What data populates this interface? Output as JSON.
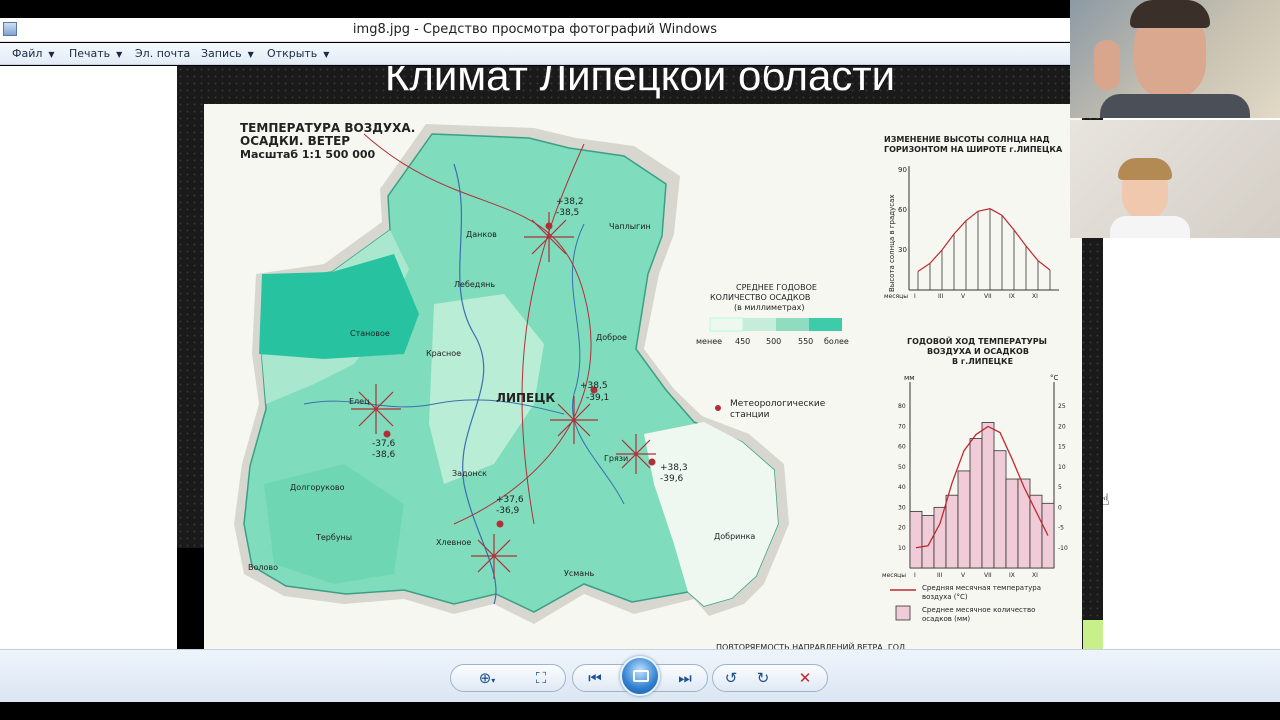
{
  "window": {
    "title": "img8.jpg - Средство просмотра фотографий Windows"
  },
  "menu": {
    "items": [
      {
        "label": "Файл",
        "has_caret": true
      },
      {
        "label": "Печать",
        "has_caret": true
      },
      {
        "label": "Эл. почта",
        "has_caret": false
      },
      {
        "label": "Запись",
        "has_caret": true
      },
      {
        "label": "Открыть",
        "has_caret": true
      }
    ]
  },
  "slide": {
    "title": "Климат Липецкой области"
  },
  "map": {
    "title_line1": "ТЕМПЕРАТУРА ВОЗДУХА.",
    "title_line2": "ОСАДКИ. ВЕТЕР",
    "scale": "Масштаб 1:1 500 000",
    "city_main": "ЛИПЕЦК",
    "legend": {
      "title_line1": "СРЕДНЕЕ ГОДОВОЕ",
      "title_line2": "КОЛИЧЕСТВО ОСАДКОВ",
      "title_line3": "(в миллиметрах)",
      "labels": [
        "менее",
        "450",
        "500",
        "550",
        "более"
      ],
      "colors": [
        "#eef8f1",
        "#c6ecdc",
        "#8fdcc0",
        "#3ecbaa"
      ]
    },
    "stations_label_line1": "Метеорологические",
    "stations_label_line2": "станции",
    "temps": [
      "+38,2",
      "-38,5",
      "+38,5",
      "-37,6",
      "-38,6",
      "+38,3",
      "-39,6",
      "+37,6",
      "-36,9",
      "-39,1"
    ],
    "towns": [
      "Данков",
      "Лебедянь",
      "Чаплыгин",
      "Становое",
      "Елец",
      "Задонск",
      "Добринка",
      "Долгоруково",
      "Тербуны",
      "Хлевное",
      "Усмань",
      "Грязи",
      "Красное",
      "Доброе",
      "Воловo"
    ],
    "bottom_caption": "ПОВТОРЯЕМОСТЬ НАПРАВЛЕНИЙ ВЕТРА, ГОД"
  },
  "sun_chart": {
    "title_line1": "ИЗМЕНЕНИЕ ВЫСОТЫ СОЛНЦА НАД",
    "title_line2": "ГОРИЗОНТОМ НА ШИРОТЕ г.ЛИПЕЦКА",
    "ylabel": "Высота солнца в градусах",
    "xlabel": "месяцы",
    "yticks": [
      "90",
      "60",
      "30"
    ],
    "xticks": [
      "I",
      "III",
      "V",
      "VII",
      "IX",
      "XI"
    ]
  },
  "climate_chart": {
    "title_line1": "ГОДОВОЙ ХОД ТЕМПЕРАТУРЫ",
    "title_line2": "ВОЗДУХА И ОСАДКОВ",
    "title_line3": "В г.ЛИПЕЦКЕ",
    "y_left_label": "мм",
    "y_right_label": "°С",
    "xlabel": "месяцы",
    "legend_temp_line1": "Средняя месячная температура",
    "legend_temp_line2": "воздуха (°С)",
    "legend_precip_line1": "Среднее месячное количество",
    "legend_precip_line2": "осадков (мм)",
    "y_left_ticks": [
      "80",
      "70",
      "60",
      "50",
      "40",
      "30",
      "20",
      "10"
    ],
    "y_right_ticks": [
      "25",
      "20",
      "15",
      "10",
      "5",
      "0",
      "-5",
      "-10"
    ],
    "xticks": [
      "I",
      "III",
      "V",
      "VII",
      "IX",
      "XI"
    ]
  },
  "chart_data": [
    {
      "type": "bar",
      "title": "ИЗМЕНЕНИЕ ВЫСОТЫ СОЛНЦА НАД ГОРИЗОНТОМ НА ШИРОТЕ г.ЛИПЕЦКА",
      "xlabel": "месяцы",
      "ylabel": "Высота солнца в градусах",
      "ylim": [
        0,
        90
      ],
      "x": [
        1,
        2,
        3,
        4,
        5,
        6,
        7,
        8,
        9,
        10,
        11,
        12
      ],
      "series": [
        {
          "values": [
            14,
            20,
            30,
            42,
            52,
            59,
            61,
            56,
            45,
            33,
            22,
            15
          ]
        }
      ]
    },
    {
      "type": "bar",
      "title": "ГОДОВОЙ ХОД ТЕМПЕРАТУРЫ ВОЗДУХА И ОСАДКОВ В г.ЛИПЕЦКЕ",
      "xlabel": "месяцы",
      "ylim": [
        0,
        90
      ],
      "x": [
        1,
        2,
        3,
        4,
        5,
        6,
        7,
        8,
        9,
        10,
        11,
        12
      ],
      "series": [
        {
          "name": "Среднее месячное количество осадков (мм)",
          "values": [
            28,
            26,
            30,
            36,
            48,
            64,
            72,
            58,
            44,
            44,
            36,
            32
          ]
        },
        {
          "name": "Средняя месячная температура воздуха (°С)",
          "values": [
            -10,
            -9.5,
            -4,
            6,
            14,
            18,
            20,
            18.5,
            12,
            5,
            -1,
            -7
          ]
        }
      ]
    }
  ],
  "toolbar": {
    "buttons": [
      "zoom",
      "fit",
      "previous",
      "slideshow",
      "next",
      "rotate-ccw",
      "rotate-cw",
      "delete"
    ]
  }
}
